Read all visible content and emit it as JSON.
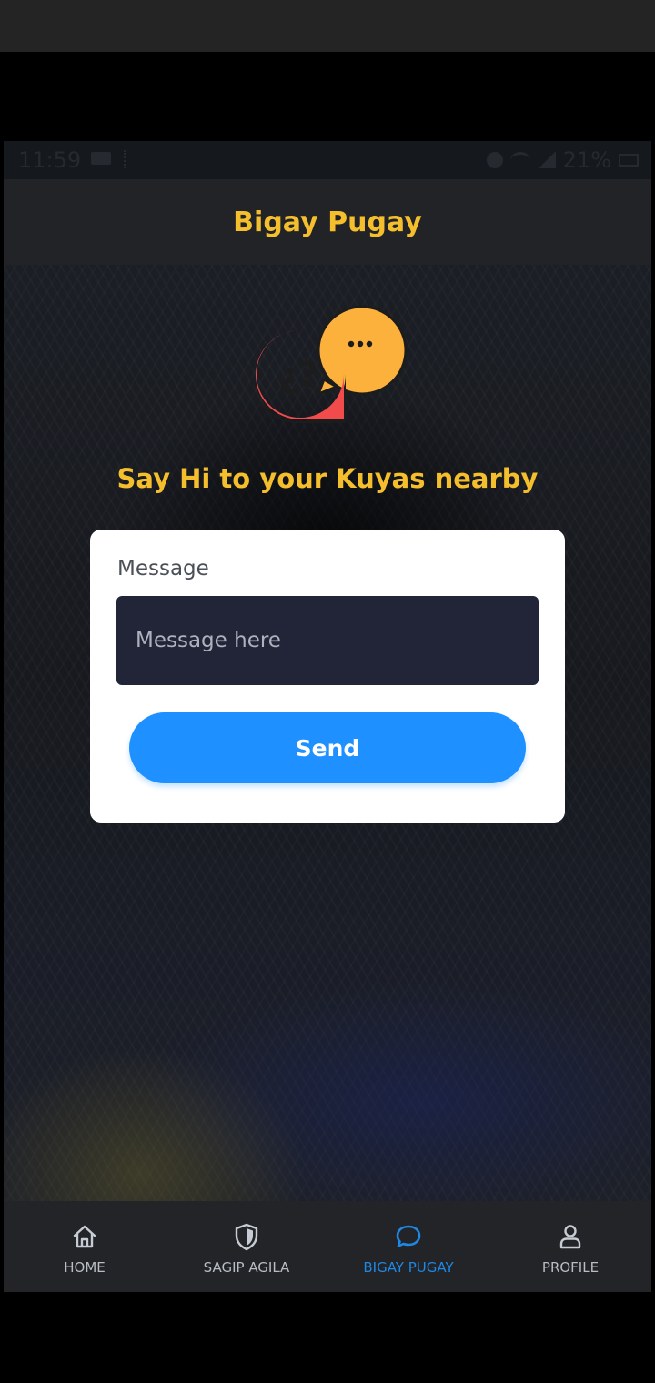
{
  "status_bar": {
    "time": "11:59",
    "battery": "21%"
  },
  "header": {
    "title": "Bigay Pugay"
  },
  "main": {
    "headline": "Say Hi to your Kuyas nearby",
    "chat_icon": {
      "name": "chat-bubbles-icon",
      "left_bubble_text": "¿?",
      "right_bubble_text": "...",
      "left_color": "#f24b4b",
      "right_color": "#fbb13c"
    },
    "form": {
      "label": "Message",
      "input_value": "",
      "input_placeholder": "Message here",
      "send_label": "Send"
    }
  },
  "bottom_nav": {
    "items": [
      {
        "label": "HOME",
        "icon": "home-icon",
        "active": false
      },
      {
        "label": "SAGIP AGILA",
        "icon": "shield-icon",
        "active": false
      },
      {
        "label": "BIGAY PUGAY",
        "icon": "chat-bubble-icon",
        "active": true
      },
      {
        "label": "PROFILE",
        "icon": "user-icon",
        "active": false
      }
    ]
  },
  "colors": {
    "accent": "#f4be2c",
    "primary": "#1e90ff",
    "nav_active": "#1e88e5",
    "header_bg": "#212327",
    "input_bg": "#222538"
  }
}
